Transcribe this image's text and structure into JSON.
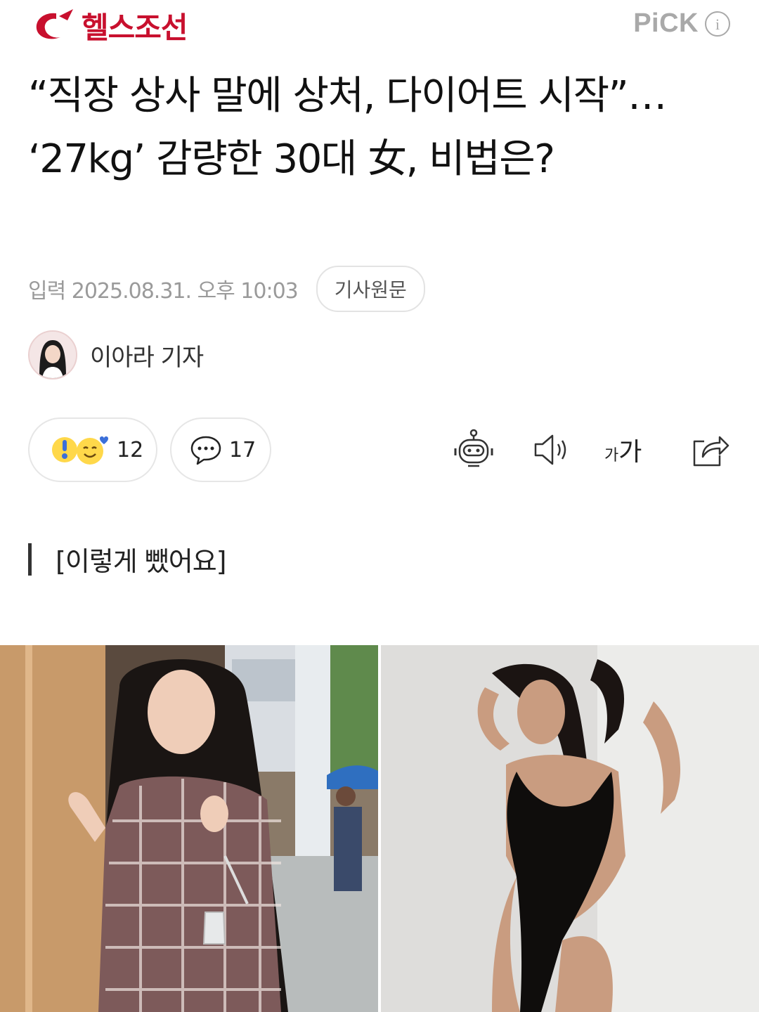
{
  "header": {
    "brand": "헬스조선",
    "pick_label": "PiCK",
    "info_glyph": "i",
    "brand_color": "#c8102e"
  },
  "article": {
    "headline": "“직장 상사 말에 상처, 다이어트 시작”… ‘27kg’ 감량한 30대 女, 비법은?",
    "published": "입력 2025.08.31. 오후 10:03",
    "source_button": "기사원문",
    "reporter": "이아라 기자"
  },
  "actions": {
    "reaction_count": "12",
    "comment_count": "17",
    "font_small": "가",
    "font_large": "가",
    "icons": [
      "reaction-emoji-icon",
      "comment-bubble-icon",
      "robot-summary-icon",
      "speaker-icon",
      "font-size-icon",
      "share-icon"
    ]
  },
  "caption": "[이렇게 뺐어요]"
}
